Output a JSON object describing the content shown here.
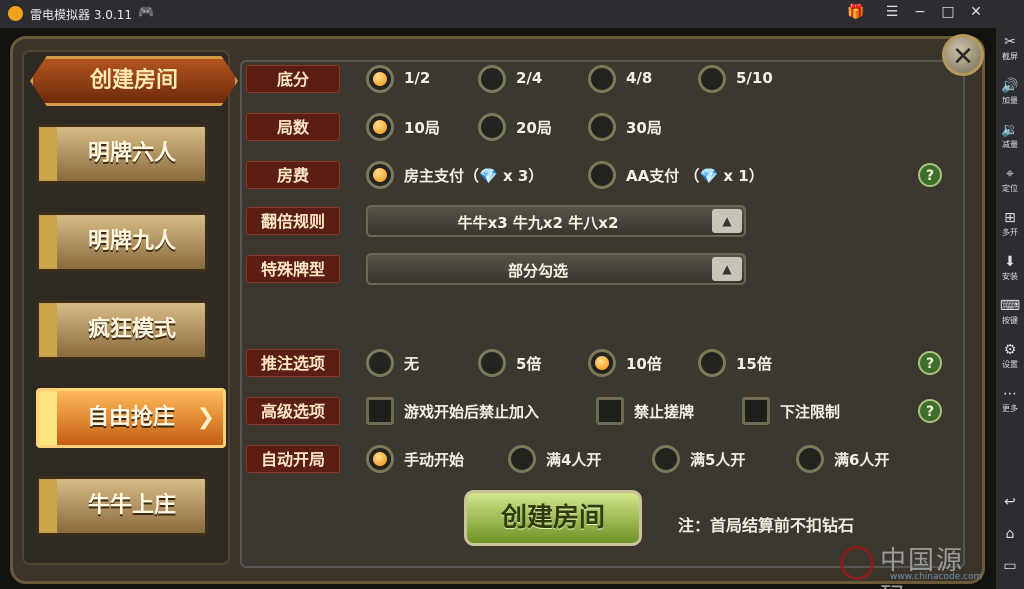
{
  "window": {
    "title": "雷电模拟器 3.0.11",
    "controls": [
      "🎁",
      "☰",
      "−",
      "□",
      "✕"
    ]
  },
  "sidebar": [
    {
      "icon": "scissors",
      "glyph": "✂",
      "label": "截屏"
    },
    {
      "icon": "volume-up",
      "glyph": "🔊",
      "label": "加量"
    },
    {
      "icon": "volume-down",
      "glyph": "🔉",
      "label": "减量"
    },
    {
      "icon": "location",
      "glyph": "⌖",
      "label": "定位"
    },
    {
      "icon": "multi-open",
      "glyph": "⊞",
      "label": "多开"
    },
    {
      "icon": "apk-install",
      "glyph": "⬇",
      "label": "安装"
    },
    {
      "icon": "keyboard",
      "glyph": "⌨",
      "label": "按键"
    },
    {
      "icon": "gear",
      "glyph": "⚙",
      "label": "设置"
    },
    {
      "icon": "more",
      "glyph": "⋯",
      "label": "更多"
    }
  ],
  "sidebar_bottom": [
    {
      "icon": "back",
      "glyph": "↩"
    },
    {
      "icon": "home",
      "glyph": "⌂"
    },
    {
      "icon": "recent",
      "glyph": "▭"
    }
  ],
  "game": {
    "title_button": "创建房间",
    "close_glyph": "✕",
    "nav": [
      {
        "label": "明牌六人",
        "active": false
      },
      {
        "label": "明牌九人",
        "active": false
      },
      {
        "label": "疯狂模式",
        "active": false
      },
      {
        "label": "自由抢庄",
        "active": true
      },
      {
        "label": "牛牛上庄",
        "active": false
      }
    ],
    "rows": {
      "score": {
        "label": "底分",
        "options": [
          {
            "text": "1/2",
            "selected": true
          },
          {
            "text": "2/4",
            "selected": false
          },
          {
            "text": "4/8",
            "selected": false
          },
          {
            "text": "5/10",
            "selected": false
          }
        ]
      },
      "rounds": {
        "label": "局数",
        "options": [
          {
            "text": "10局",
            "selected": true
          },
          {
            "text": "20局",
            "selected": false
          },
          {
            "text": "30局",
            "selected": false
          }
        ]
      },
      "fee": {
        "label": "房费",
        "options": [
          {
            "text": "房主支付（",
            "gem_count": "x 3）",
            "selected": true
          },
          {
            "text": "AA支付 （",
            "gem_count": "x 1）",
            "selected": false
          }
        ]
      },
      "double_rule": {
        "label": "翻倍规则",
        "value": "牛牛x3  牛九x2  牛八x2"
      },
      "special": {
        "label": "特殊牌型",
        "value": "部分勾选"
      },
      "bet": {
        "label": "推注选项",
        "options": [
          {
            "text": "无",
            "selected": false
          },
          {
            "text": "5倍",
            "selected": false
          },
          {
            "text": "10倍",
            "selected": true
          },
          {
            "text": "15倍",
            "selected": false
          }
        ]
      },
      "advanced": {
        "label": "高级选项",
        "checks": [
          {
            "text": "游戏开始后禁止加入",
            "checked": false
          },
          {
            "text": "禁止搓牌",
            "checked": false
          },
          {
            "text": "下注限制",
            "checked": false
          }
        ]
      },
      "auto_start": {
        "label": "自动开局",
        "options": [
          {
            "text": "手动开始",
            "selected": true
          },
          {
            "text": "满4人开",
            "selected": false
          },
          {
            "text": "满5人开",
            "selected": false
          },
          {
            "text": "满6人开",
            "selected": false
          }
        ]
      }
    },
    "create_button": "创建房间",
    "note": "注：首局结算前不扣钻石",
    "help_glyph": "?",
    "dropdown_glyph": "▲"
  },
  "watermark": {
    "title": "中国源码",
    "url": "www.chinacode.com"
  }
}
